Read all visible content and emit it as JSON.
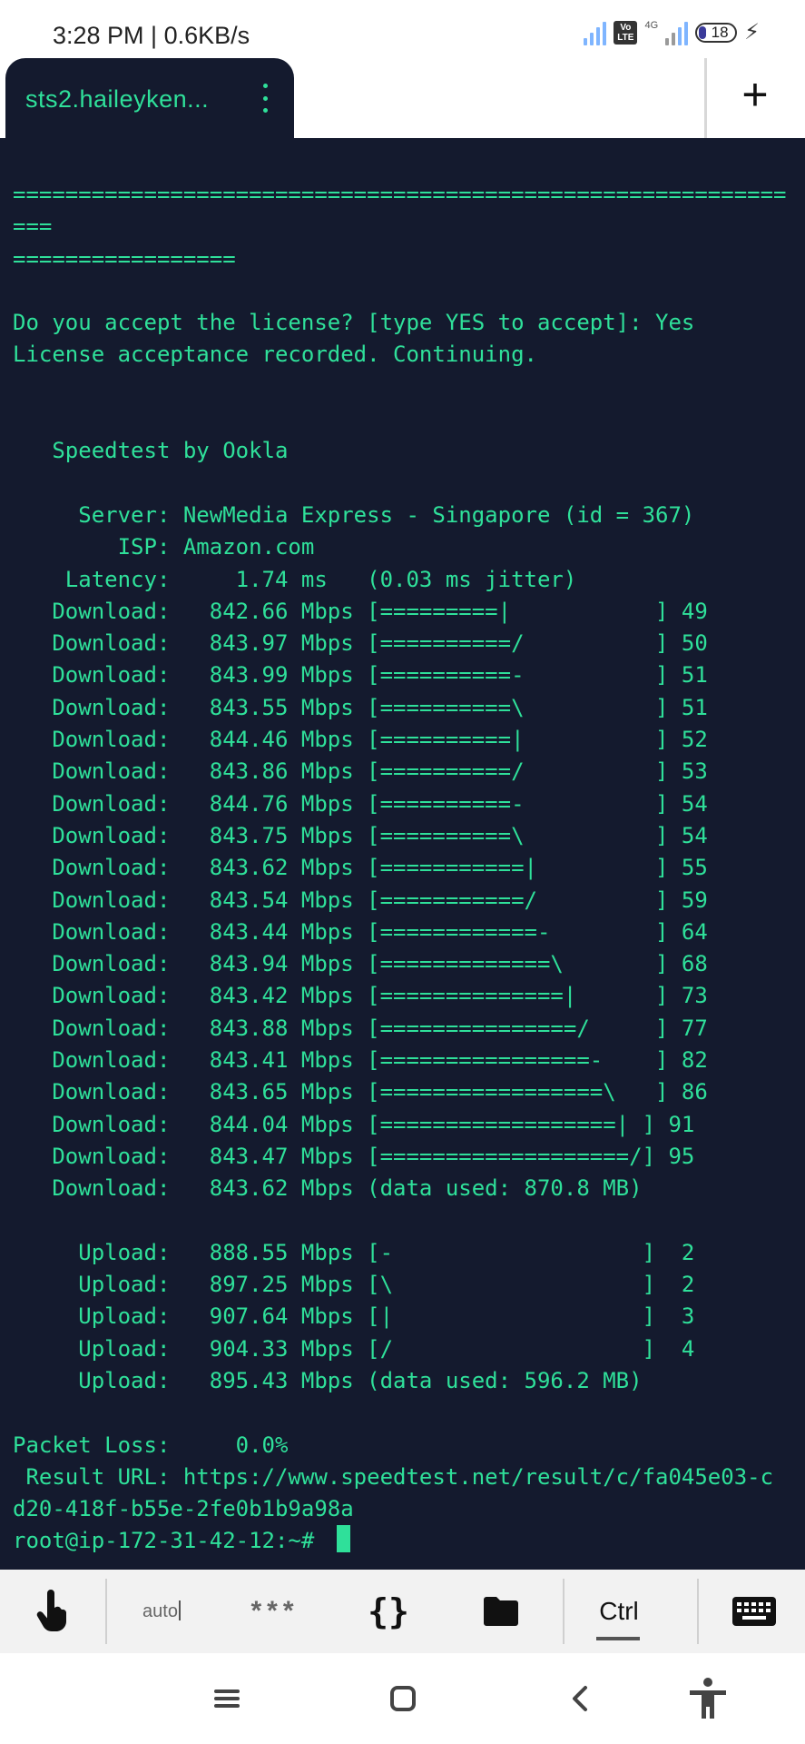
{
  "status_bar": {
    "time_speed": "3:28 PM | 0.6KB/s",
    "volte": "Vo LTE",
    "network": "4G",
    "battery": "18",
    "charging_icon": "lightning-icon",
    "accent_color": "#7fb5ff"
  },
  "tabs": {
    "active_title": "sts2.haileyken...",
    "menu_icon": "more-vertical-icon",
    "new_tab_icon": "plus-icon",
    "new_tab_label": "+"
  },
  "terminal": {
    "background_color": "#141a2e",
    "text_color": "#2fe09a",
    "lines": [
      "===========================================================",
      "===",
      "=================",
      "",
      "Do you accept the license? [type YES to accept]: Yes",
      "License acceptance recorded. Continuing.",
      "",
      "",
      "   Speedtest by Ookla",
      "",
      "     Server: NewMedia Express - Singapore (id = 367)",
      "        ISP: Amazon.com",
      "    Latency:     1.74 ms   (0.03 ms jitter)",
      "   Download:   842.66 Mbps [=========|           ] 49",
      "   Download:   843.97 Mbps [==========/          ] 50",
      "   Download:   843.99 Mbps [==========-          ] 51",
      "   Download:   843.55 Mbps [==========\\          ] 51",
      "   Download:   844.46 Mbps [==========|          ] 52",
      "   Download:   843.86 Mbps [==========/          ] 53",
      "   Download:   844.76 Mbps [==========-          ] 54",
      "   Download:   843.75 Mbps [==========\\          ] 54",
      "   Download:   843.62 Mbps [===========|         ] 55",
      "   Download:   843.54 Mbps [===========/         ] 59",
      "   Download:   843.44 Mbps [============-        ] 64",
      "   Download:   843.94 Mbps [=============\\       ] 68",
      "   Download:   843.42 Mbps [==============|      ] 73",
      "   Download:   843.88 Mbps [===============/     ] 77",
      "   Download:   843.41 Mbps [================-    ] 82",
      "   Download:   843.65 Mbps [=================\\   ] 86",
      "   Download:   844.04 Mbps [==================| ] 91",
      "   Download:   843.47 Mbps [===================/] 95",
      "   Download:   843.62 Mbps (data used: 870.8 MB)",
      "",
      "     Upload:   888.55 Mbps [-                   ]  2",
      "     Upload:   897.25 Mbps [\\                   ]  2",
      "     Upload:   907.64 Mbps [|                   ]  3",
      "     Upload:   904.33 Mbps [/                   ]  4",
      "     Upload:   895.43 Mbps (data used: 596.2 MB)",
      "",
      "Packet Loss:     0.0%",
      " Result URL: https://www.speedtest.net/result/c/fa045e03-c",
      "d20-418f-b55e-2fe0b1b9a98a"
    ],
    "prompt": "root@ip-172-31-42-12:~# "
  },
  "toolbar": {
    "touch_icon": "touch-hand-icon",
    "auto_label": "auto",
    "stars_label": "***",
    "braces_label": "{}",
    "folder_icon": "folder-icon",
    "ctrl_label": "Ctrl",
    "keyboard_icon": "keyboard-icon"
  },
  "nav_bar": {
    "menu_icon": "menu-icon",
    "home_icon": "home-square-icon",
    "back_icon": "back-chevron-icon",
    "accessibility_icon": "accessibility-icon"
  }
}
